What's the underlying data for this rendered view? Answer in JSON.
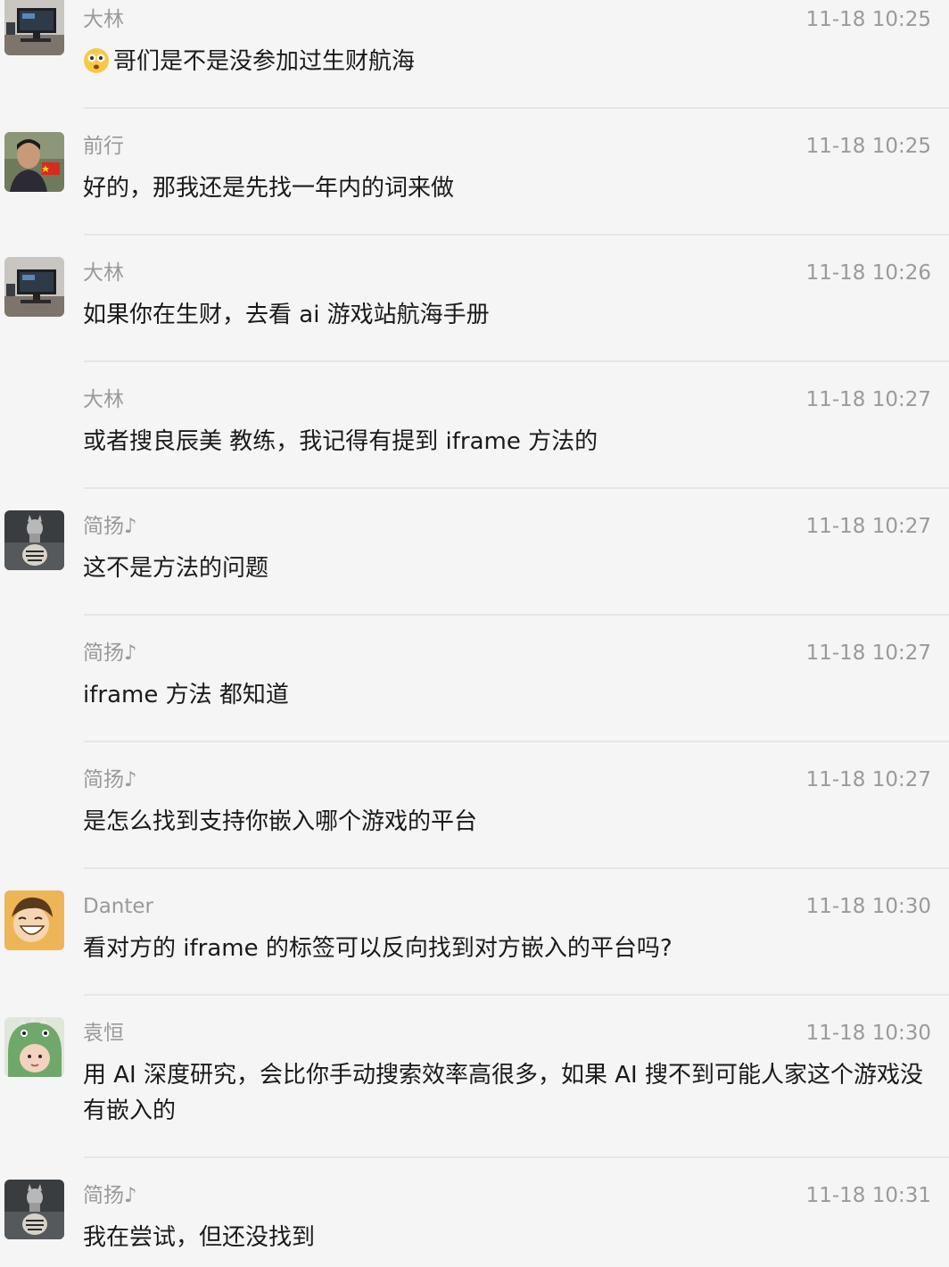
{
  "colors": {
    "background": "#f5f5f5",
    "meta_text": "#9a9a9a",
    "message_text": "#1a1a1a",
    "divider": "#e6e6e6"
  },
  "messages": [
    {
      "sender": "大林",
      "time": "11-18 10:25",
      "text": "哥们是不是没参加过生财航海",
      "leading_icon": "astonished-face-icon",
      "avatar": "monitor-desk-avatar"
    },
    {
      "sender": "前行",
      "time": "11-18 10:25",
      "text": "好的，那我还是先找一年内的词来做",
      "avatar": "person-flag-avatar"
    },
    {
      "sender": "大林",
      "time": "11-18 10:26",
      "text": "如果你在生财，去看 ai 游戏站航海手册",
      "avatar": "monitor-desk-avatar"
    },
    {
      "sender": "大林",
      "time": "11-18 10:27",
      "text": "或者搜良辰美 教练，我记得有提到 iframe 方法的",
      "avatar": ""
    },
    {
      "sender": "简扬♪",
      "time": "11-18 10:27",
      "text": "这不是方法的问题",
      "avatar": "cat-tiger-reflection-avatar"
    },
    {
      "sender": "简扬♪",
      "time": "11-18 10:27",
      "text": "iframe 方法 都知道",
      "avatar": ""
    },
    {
      "sender": "简扬♪",
      "time": "11-18 10:27",
      "text": "是怎么找到支持你嵌入哪个游戏的平台",
      "avatar": ""
    },
    {
      "sender": "Danter",
      "time": "11-18 10:30",
      "text": "看对方的 iframe 的标签可以反向找到对方嵌入的平台吗?",
      "avatar": "cartoon-boy-avatar"
    },
    {
      "sender": "袁恒",
      "time": "11-18 10:30",
      "text": "用 AI 深度研究，会比你手动搜索效率高很多，如果 AI 搜不到可能人家这个游戏没有嵌入的",
      "avatar": "baby-dino-hat-avatar"
    },
    {
      "sender": "简扬♪",
      "time": "11-18 10:31",
      "text": "我在尝试，但还没找到",
      "avatar": "cat-tiger-reflection-avatar"
    }
  ]
}
